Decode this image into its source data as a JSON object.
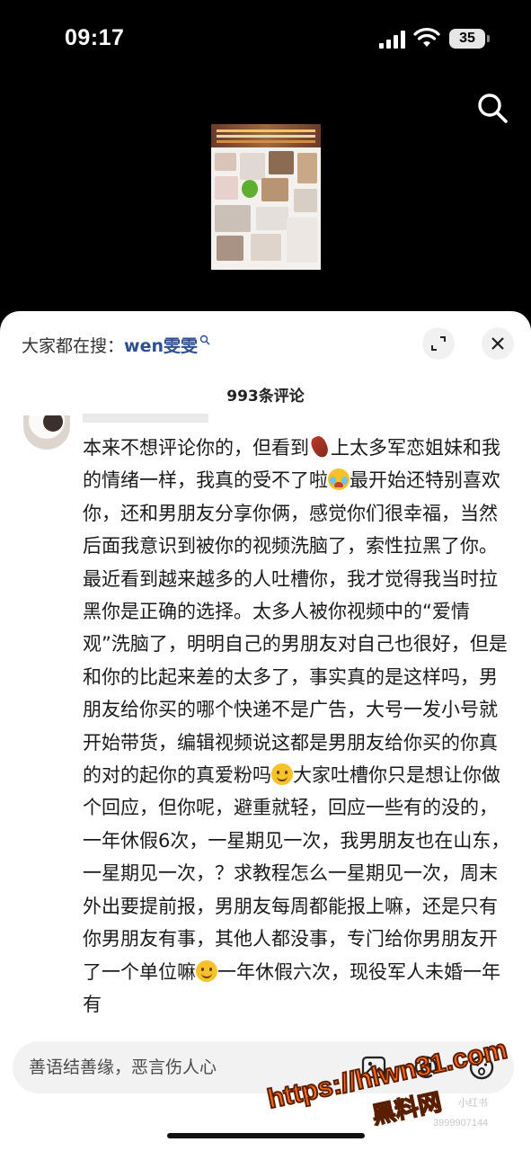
{
  "status_bar": {
    "time": "09:17",
    "battery": "35"
  },
  "top_bar": {
    "search_icon": "search-icon"
  },
  "comments_panel": {
    "hot_search_prefix": "大家都在搜：",
    "hot_search_keyword": "wen雯雯",
    "expand_icon": "expand-icon",
    "close_icon": "close-icon",
    "comment_count": "993条评论",
    "comment": {
      "segments": [
        {
          "type": "text",
          "value": "本来不想评论你的，但看到"
        },
        {
          "type": "emoji",
          "name": "sweet-potato-emoji"
        },
        {
          "type": "text",
          "value": "上太多军恋姐妹和我的情绪一样，我真的受不了啦"
        },
        {
          "type": "emoji",
          "name": "crying-face-emoji"
        },
        {
          "type": "text",
          "value": "最开始还特别喜欢你，还和男朋友分享你俩，感觉你们很幸福，当然后面我意识到被你的视频洗脑了，索性拉黑了你。最近看到越来越多的人吐槽你，我才觉得我当时拉黑你是正确的选择。太多人被你视频中的“爱情观”洗脑了，明明自己的男朋友对自己也很好，但是和你的比起来差的太多了，事实真的是这样吗，男朋友给你买的哪个快递不是广告，大号一发小号就开始带货，编辑视频说这都是男朋友给你买的你真的对的起你的真爱粉吗"
        },
        {
          "type": "emoji",
          "name": "smile-face-emoji"
        },
        {
          "type": "text",
          "value": "大家吐槽你只是想让你做个回应，但你呢，避重就轻，回应一些有的没的，一年休假6次，一星期见一次，我男朋友也在山东，一星期见一次，？求教程怎么一星期见一次，周末外出要提前报，男朋友每周都能报上嘛，还是只有你男朋友有事，其他人都没事，专门给你男朋友开了一个单位嘛"
        },
        {
          "type": "emoji",
          "name": "smile-face-emoji"
        },
        {
          "type": "text",
          "value": "一年休假六次，现役军人未婚一年有"
        }
      ]
    },
    "input_placeholder": "善语结善缘，恶言伤人心",
    "toolbar_icons": [
      "image-icon",
      "mention-icon",
      "emoji-icon"
    ]
  },
  "watermark": {
    "url": "https://hlwn31.com",
    "name": "黑料网",
    "small_tag": "小红书",
    "id_text": "3999907144"
  }
}
